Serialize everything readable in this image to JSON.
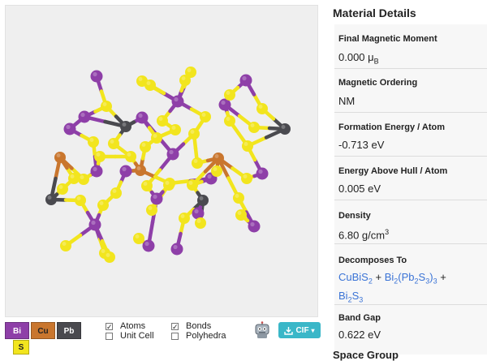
{
  "viewer": {
    "colors": {
      "Bi": "#8e3fa8",
      "Cu": "#c9762e",
      "Pb": "#4a4a4f",
      "S": "#f2e51e"
    },
    "legend": [
      {
        "label": "Bi",
        "color": "#8e3fa8"
      },
      {
        "label": "Cu",
        "color": "#c9762e"
      },
      {
        "label": "Pb",
        "color": "#4a4a4f"
      },
      {
        "label": "S",
        "color": "#f2e51e"
      }
    ],
    "options": {
      "atoms": {
        "label": "Atoms",
        "checked": true
      },
      "unit_cell": {
        "label": "Unit Cell",
        "checked": false
      },
      "bonds": {
        "label": "Bonds",
        "checked": true
      },
      "polyhedra": {
        "label": "Polyhedra",
        "checked": false
      }
    },
    "robot_icon": "robot-icon",
    "download_button": {
      "label": "CIF",
      "icon": "download-icon"
    }
  },
  "details": {
    "title": "Material Details",
    "final_magnetic_moment": {
      "label": "Final Magnetic Moment",
      "value": "0.000 μ",
      "unit_sub": "B"
    },
    "magnetic_ordering": {
      "label": "Magnetic Ordering",
      "value": "NM"
    },
    "formation_energy": {
      "label": "Formation Energy / Atom",
      "value": "-0.713 eV"
    },
    "energy_above_hull": {
      "label": "Energy Above Hull / Atom",
      "value": "0.005 eV"
    },
    "density": {
      "label": "Density",
      "value": "6.80 g/cm",
      "sup": "3"
    },
    "decomposes_to": {
      "label": "Decomposes To",
      "p1_a": "CuBiS",
      "p1_b": "2",
      "plus1": " + ",
      "p2_a": "Bi",
      "p2_b": "2",
      "p2_c": "(Pb",
      "p2_d": "2",
      "p2_e": "S",
      "p2_f": "3",
      "p2_g": ")",
      "p2_h": "3",
      "plus2": " +",
      "p3_a": "Bi",
      "p3_b": "2",
      "p3_c": "S",
      "p3_d": "3"
    },
    "band_gap": {
      "label": "Band Gap",
      "value": "0.622 eV"
    },
    "next_section_partial": "Space Group"
  }
}
